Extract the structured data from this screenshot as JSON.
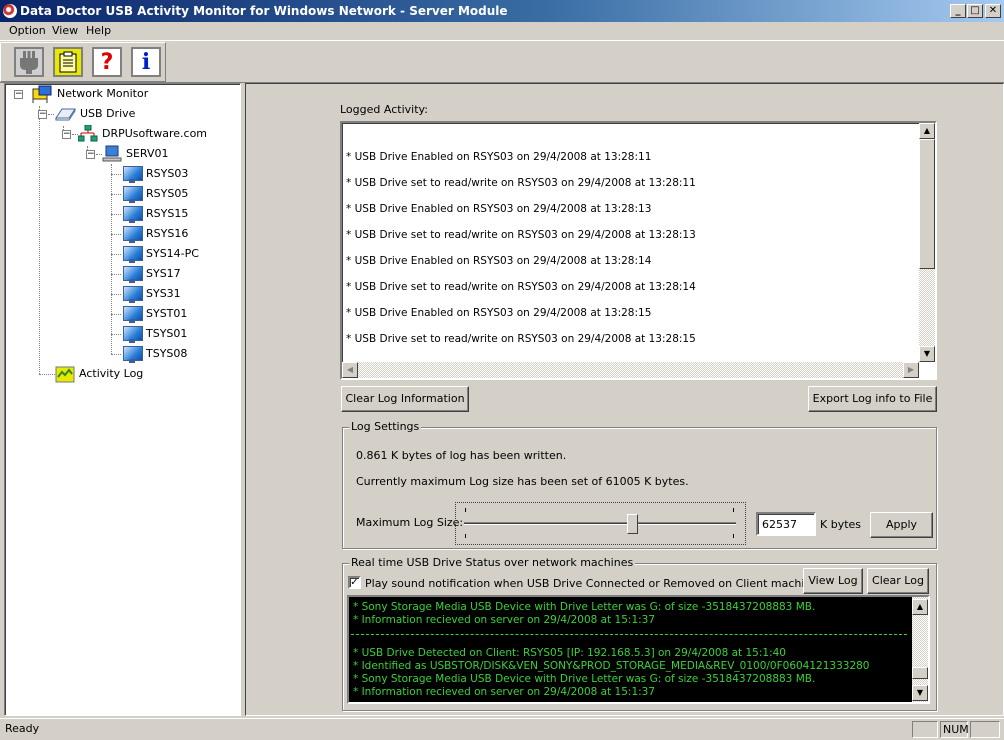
{
  "window": {
    "title": "Data Doctor USB Activity Monitor for Windows Network - Server Module",
    "controls": {
      "minimize": "_",
      "maximize": "□",
      "close": "✕"
    }
  },
  "menu": [
    {
      "label": "Option",
      "accel": "O"
    },
    {
      "label": "View",
      "accel": "V"
    },
    {
      "label": "Help",
      "accel": "H"
    }
  ],
  "toolbar": [
    {
      "name": "connect",
      "icon": "plug-icon",
      "glyph": "🔌"
    },
    {
      "name": "log",
      "icon": "clipboard-icon",
      "glyph": "📋"
    },
    {
      "name": "help",
      "icon": "help-icon",
      "glyph": "?"
    },
    {
      "name": "about",
      "icon": "info-icon",
      "glyph": "i"
    }
  ],
  "tree": {
    "root": "Network Monitor",
    "usb_drive": "USB Drive",
    "domain": "DRPUsoftware.com",
    "server": "SERV01",
    "clients": [
      "RSYS03",
      "RSYS05",
      "RSYS15",
      "RSYS16",
      "SYS14-PC",
      "SYS17",
      "SYS31",
      "SYST01",
      "TSYS01",
      "TSYS08"
    ],
    "activity_log": "Activity Log"
  },
  "logged_activity": {
    "label": "Logged Activity:",
    "entries": [
      "* USB Drive Enabled on RSYS03 on 29/4/2008 at 13:28:11",
      "* USB Drive set to read/write on RSYS03 on 29/4/2008 at 13:28:11",
      "* USB Drive Enabled on RSYS03 on 29/4/2008 at 13:28:13",
      "* USB Drive set to read/write on RSYS03 on 29/4/2008 at 13:28:13",
      "* USB Drive Enabled on RSYS03 on 29/4/2008 at 13:28:14",
      "* USB Drive set to read/write on RSYS03 on 29/4/2008 at 13:28:14",
      "* USB Drive Enabled on RSYS03 on 29/4/2008 at 13:28:15",
      "* USB Drive set to read/write on RSYS03 on 29/4/2008 at 13:28:15"
    ],
    "clear_button": "Clear Log Information",
    "export_button": "Export Log info to File"
  },
  "log_settings": {
    "title": "Log Settings",
    "written_text": "0.861 K bytes of log has been written.",
    "max_text": "Currently maximum Log size has been set of 61005 K bytes.",
    "max_label": "Maximum Log Size:",
    "slider_fraction": 0.62,
    "size_value": "62537",
    "unit": "K bytes",
    "apply_button": "Apply"
  },
  "realtime": {
    "title": "Real time USB Drive Status over network machines",
    "sound_checkbox_label": "Play sound notification when USB Drive Connected or Removed on Client machines",
    "sound_checked": true,
    "view_log_button": "View Log",
    "clear_log_button": "Clear Log",
    "console_lines": [
      "* Sony Storage Media USB Device  with Drive Letter was G: of size -3518437208883 MB.",
      "* Information recieved on server on 29/4/2008 at 15:1:37",
      "---",
      "* USB Drive Detected on Client: RSYS05 [IP: 192.168.5.3] on 29/4/2008 at 15:1:40",
      "* Identified as USBSTOR/DISK&VEN_SONY&PROD_STORAGE_MEDIA&REV_0100/0F0604121333280",
      "* Sony Storage Media USB Device  with Drive Letter was G: of size -3518437208883 MB.",
      "* Information recieved on server on 29/4/2008 at 15:1:37",
      "---"
    ]
  },
  "statusbar": {
    "text": "Ready",
    "panel1": "",
    "num": "NUM",
    "panel3": ""
  }
}
